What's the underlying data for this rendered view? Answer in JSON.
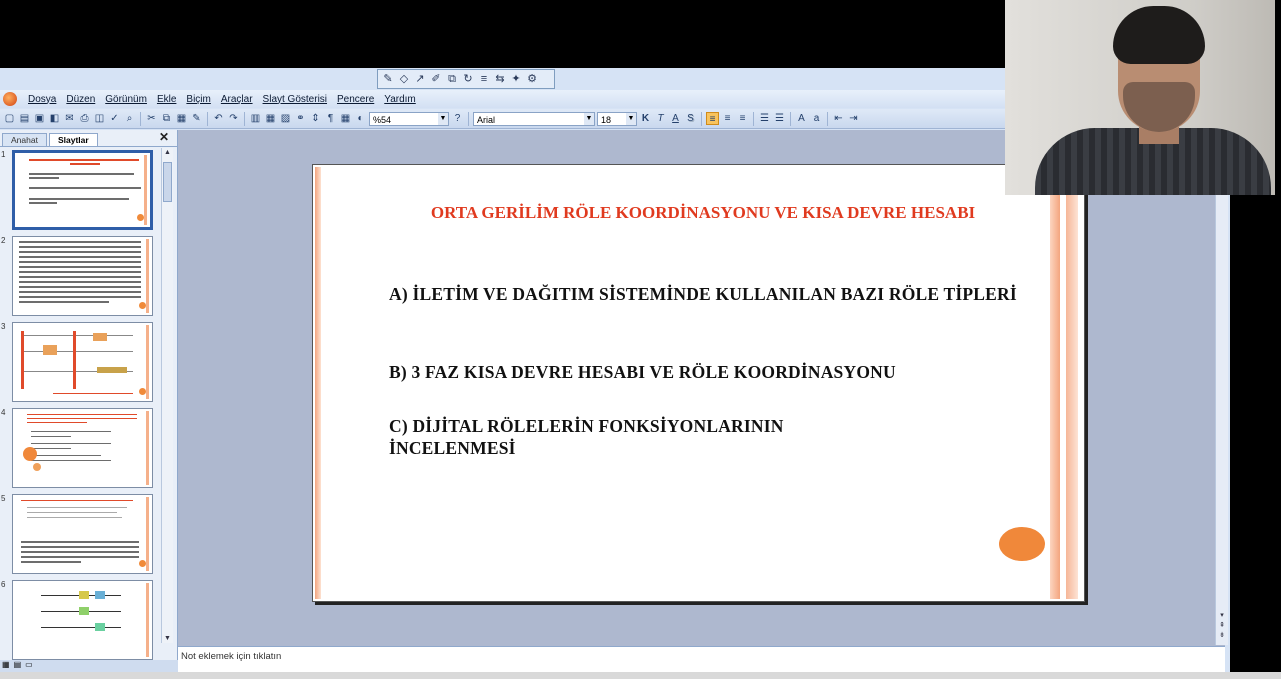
{
  "menu": [
    "Dosya",
    "Düzen",
    "Görünüm",
    "Ekle",
    "Biçim",
    "Araçlar",
    "Slayt Gösterisi",
    "Pencere",
    "Yardım"
  ],
  "toolbar": {
    "zoom": "%54",
    "font": "Arial",
    "font_size": "18",
    "bold": "K",
    "italic": "T",
    "underline": "A",
    "shadow": "S"
  },
  "left_pane": {
    "tabs": [
      "Anahat",
      "Slaytlar"
    ],
    "active_tab": "Slaytlar",
    "slide_numbers": [
      "1",
      "2",
      "3",
      "4",
      "5",
      "6"
    ],
    "selected_slide": 1
  },
  "slide": {
    "title": "ORTA GERİLİM RÖLE KOORDİNASYONU VE KISA DEVRE HESABI",
    "items": [
      "A) İLETİM VE DAĞITIM SİSTEMİNDE KULLANILAN BAZI RÖLE TİPLERİ",
      "B) 3 FAZ KISA DEVRE HESABI VE RÖLE KOORDİNASYONU",
      "C) DİJİTAL RÖLELERİN FONKSİYONLARININ İNCELENMESİ"
    ]
  },
  "notes_placeholder": "Not eklemek için tıklatın",
  "colors": {
    "title_red": "#e03a1f",
    "accent_orange": "#f0883a",
    "selection_blue": "#2f5ea8"
  }
}
